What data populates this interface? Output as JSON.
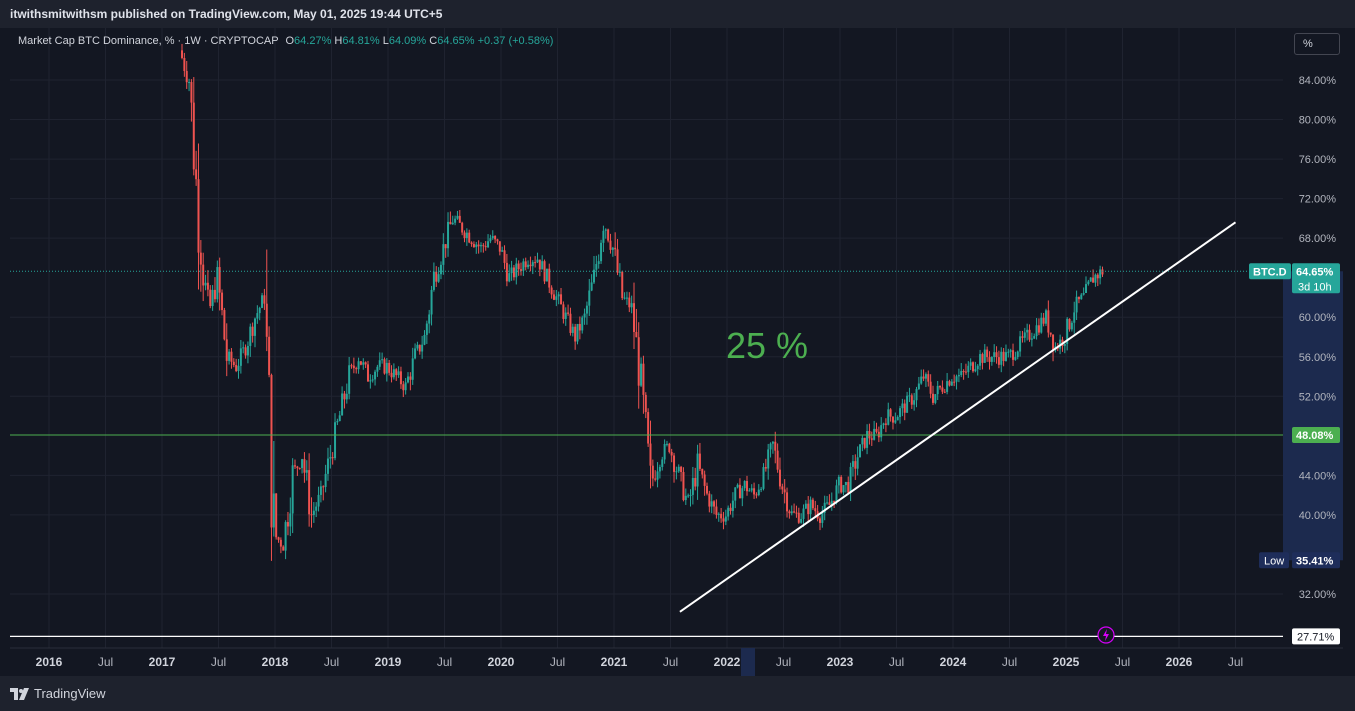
{
  "header": {
    "published_by": "itwithsmitwithsm published on TradingView.com, May 01, 2025 19:44 UTC+5"
  },
  "footer": {
    "brand": "TradingView"
  },
  "legend": {
    "symbol": "Market Cap BTC Dominance, % · 1W · CRYPTOCAP",
    "o_label": "O",
    "o_value": "64.27%",
    "h_label": "H",
    "h_value": "64.81%",
    "l_label": "L",
    "l_value": "64.09%",
    "c_label": "C",
    "c_value": "64.65%",
    "change": "+0.37 (+0.58%)"
  },
  "scale_button": "%",
  "annotation": "25 %",
  "price_labels": {
    "symbol_tag": "BTC.D",
    "current": "64.65%",
    "countdown": "3d 10h",
    "level": "48.08%",
    "low_tag": "Low",
    "low_value": "35.41%",
    "bottom_value": "27.71%"
  },
  "colors": {
    "background": "#131722",
    "up": "#26a69a",
    "down": "#ef5350",
    "annotation": "#4caf50",
    "level_line": "#4caf50",
    "trendline": "#ffffff",
    "highlight_axis": "#2962ff"
  },
  "chart_data": {
    "type": "candlestick",
    "title": "Market Cap BTC Dominance, %",
    "interval": "1W",
    "exchange": "CRYPTOCAP",
    "y_ticks": [
      "84.00%",
      "80.00%",
      "76.00%",
      "72.00%",
      "68.00%",
      "60.00%",
      "56.00%",
      "52.00%",
      "44.00%",
      "40.00%",
      "32.00%"
    ],
    "x_ticks": [
      "2016",
      "Jul",
      "2017",
      "Jul",
      "2018",
      "Jul",
      "2019",
      "Jul",
      "2020",
      "Jul",
      "2021",
      "Jul",
      "2022",
      "Jul",
      "2023",
      "Jul",
      "2024",
      "Jul",
      "2025",
      "Jul",
      "2026",
      "Jul"
    ],
    "ylim": [
      27,
      87
    ],
    "series": [
      {
        "name": "BTC.D",
        "points": [
          {
            "x": "2017-03",
            "y": 87
          },
          {
            "x": "2017-04",
            "y": 84
          },
          {
            "x": "2017-05",
            "y": 70
          },
          {
            "x": "2017-06",
            "y": 60
          },
          {
            "x": "2017-07",
            "y": 64
          },
          {
            "x": "2017-08",
            "y": 56
          },
          {
            "x": "2017-09",
            "y": 55
          },
          {
            "x": "2017-10",
            "y": 57
          },
          {
            "x": "2017-11",
            "y": 60
          },
          {
            "x": "2017-12",
            "y": 62
          },
          {
            "x": "2018-01",
            "y": 38
          },
          {
            "x": "2018-02",
            "y": 37
          },
          {
            "x": "2018-03",
            "y": 44
          },
          {
            "x": "2018-04",
            "y": 46
          },
          {
            "x": "2018-05",
            "y": 40
          },
          {
            "x": "2018-06",
            "y": 42
          },
          {
            "x": "2018-07",
            "y": 46
          },
          {
            "x": "2018-08",
            "y": 50
          },
          {
            "x": "2018-09",
            "y": 54
          },
          {
            "x": "2018-10",
            "y": 56
          },
          {
            "x": "2018-11",
            "y": 54
          },
          {
            "x": "2018-12",
            "y": 55
          },
          {
            "x": "2019-01",
            "y": 55
          },
          {
            "x": "2019-02",
            "y": 54
          },
          {
            "x": "2019-03",
            "y": 53
          },
          {
            "x": "2019-04",
            "y": 56
          },
          {
            "x": "2019-05",
            "y": 58
          },
          {
            "x": "2019-06",
            "y": 64
          },
          {
            "x": "2019-07",
            "y": 67
          },
          {
            "x": "2019-08",
            "y": 70
          },
          {
            "x": "2019-09",
            "y": 69
          },
          {
            "x": "2019-10",
            "y": 68
          },
          {
            "x": "2019-11",
            "y": 67
          },
          {
            "x": "2019-12",
            "y": 68
          },
          {
            "x": "2020-01",
            "y": 67
          },
          {
            "x": "2020-02",
            "y": 64
          },
          {
            "x": "2020-03",
            "y": 65
          },
          {
            "x": "2020-04",
            "y": 66
          },
          {
            "x": "2020-05",
            "y": 66
          },
          {
            "x": "2020-06",
            "y": 64
          },
          {
            "x": "2020-07",
            "y": 62
          },
          {
            "x": "2020-08",
            "y": 60
          },
          {
            "x": "2020-09",
            "y": 58
          },
          {
            "x": "2020-10",
            "y": 60
          },
          {
            "x": "2020-11",
            "y": 64
          },
          {
            "x": "2020-12",
            "y": 70
          },
          {
            "x": "2021-01",
            "y": 67
          },
          {
            "x": "2021-02",
            "y": 62
          },
          {
            "x": "2021-03",
            "y": 61
          },
          {
            "x": "2021-04",
            "y": 53
          },
          {
            "x": "2021-05",
            "y": 43
          },
          {
            "x": "2021-06",
            "y": 46
          },
          {
            "x": "2021-07",
            "y": 47
          },
          {
            "x": "2021-08",
            "y": 44
          },
          {
            "x": "2021-09",
            "y": 41
          },
          {
            "x": "2021-10",
            "y": 45
          },
          {
            "x": "2021-11",
            "y": 42
          },
          {
            "x": "2021-12",
            "y": 40
          },
          {
            "x": "2022-01",
            "y": 40
          },
          {
            "x": "2022-02",
            "y": 42
          },
          {
            "x": "2022-03",
            "y": 43
          },
          {
            "x": "2022-04",
            "y": 42
          },
          {
            "x": "2022-05",
            "y": 44
          },
          {
            "x": "2022-06",
            "y": 47
          },
          {
            "x": "2022-07",
            "y": 43
          },
          {
            "x": "2022-08",
            "y": 40
          },
          {
            "x": "2022-09",
            "y": 40
          },
          {
            "x": "2022-10",
            "y": 41
          },
          {
            "x": "2022-11",
            "y": 40
          },
          {
            "x": "2022-12",
            "y": 41
          },
          {
            "x": "2023-01",
            "y": 43
          },
          {
            "x": "2023-02",
            "y": 43
          },
          {
            "x": "2023-03",
            "y": 46
          },
          {
            "x": "2023-04",
            "y": 48
          },
          {
            "x": "2023-05",
            "y": 48
          },
          {
            "x": "2023-06",
            "y": 50
          },
          {
            "x": "2023-07",
            "y": 50
          },
          {
            "x": "2023-08",
            "y": 51
          },
          {
            "x": "2023-09",
            "y": 52
          },
          {
            "x": "2023-10",
            "y": 54
          },
          {
            "x": "2023-11",
            "y": 52
          },
          {
            "x": "2023-12",
            "y": 53
          },
          {
            "x": "2024-01",
            "y": 54
          },
          {
            "x": "2024-02",
            "y": 54
          },
          {
            "x": "2024-03",
            "y": 55
          },
          {
            "x": "2024-04",
            "y": 56
          },
          {
            "x": "2024-05",
            "y": 56
          },
          {
            "x": "2024-06",
            "y": 56
          },
          {
            "x": "2024-07",
            "y": 56
          },
          {
            "x": "2024-08",
            "y": 57
          },
          {
            "x": "2024-09",
            "y": 58
          },
          {
            "x": "2024-10",
            "y": 59
          },
          {
            "x": "2024-11",
            "y": 60
          },
          {
            "x": "2024-12",
            "y": 57
          },
          {
            "x": "2025-01",
            "y": 58
          },
          {
            "x": "2025-02",
            "y": 61
          },
          {
            "x": "2025-03",
            "y": 62
          },
          {
            "x": "2025-04",
            "y": 64
          },
          {
            "x": "2025-05",
            "y": 64.65
          }
        ]
      }
    ],
    "levels": [
      {
        "name": "horizontal",
        "value": 48.08
      },
      {
        "name": "current",
        "value": 64.65
      },
      {
        "name": "low",
        "value": 35.41
      },
      {
        "name": "bottom",
        "value": 27.71
      }
    ],
    "trendline": {
      "from": {
        "x": "2021-08",
        "y": 30.2
      },
      "to": {
        "x": "2026-07",
        "y": 69.6
      }
    },
    "grid": true,
    "legend_position": "top-left"
  }
}
